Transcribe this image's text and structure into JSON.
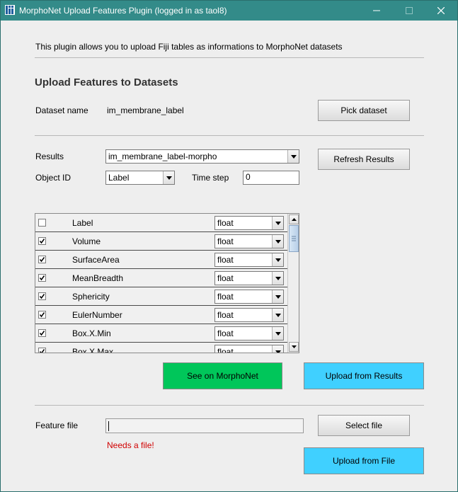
{
  "window": {
    "title": "MorphoNet Upload Features Plugin (logged in as taol8)",
    "icon": "fiji-icon"
  },
  "intro": "This plugin allows you to upload Fiji tables as informations to MorphoNet datasets",
  "section_title": "Upload Features to Datasets",
  "dataset": {
    "label": "Dataset name",
    "value": "im_membrane_label",
    "pick_button": "Pick dataset"
  },
  "results": {
    "label": "Results",
    "selected": "im_membrane_label-morpho",
    "refresh_button": "Refresh Results",
    "object_id_label": "Object ID",
    "object_id_selected": "Label",
    "time_step_label": "Time step",
    "time_step_value": "0"
  },
  "features": [
    {
      "name": "Label",
      "checked": false,
      "type": "float"
    },
    {
      "name": "Volume",
      "checked": true,
      "type": "float"
    },
    {
      "name": "SurfaceArea",
      "checked": true,
      "type": "float"
    },
    {
      "name": "MeanBreadth",
      "checked": true,
      "type": "float"
    },
    {
      "name": "Sphericity",
      "checked": true,
      "type": "float"
    },
    {
      "name": "EulerNumber",
      "checked": true,
      "type": "float"
    },
    {
      "name": "Box.X.Min",
      "checked": true,
      "type": "float"
    },
    {
      "name": "Box.X.Max",
      "checked": true,
      "type": "float"
    }
  ],
  "actions": {
    "see_on_morphonet": "See on MorphoNet",
    "upload_from_results": "Upload from Results"
  },
  "feature_file": {
    "label": "Feature file",
    "value": "",
    "select_button": "Select file",
    "error": "Needs a file!",
    "upload_button": "Upload from File"
  },
  "colors": {
    "titlebar": "#338b89",
    "green_button": "#00c65a",
    "cyan_button": "#40d0ff",
    "error_text": "#d00000"
  }
}
